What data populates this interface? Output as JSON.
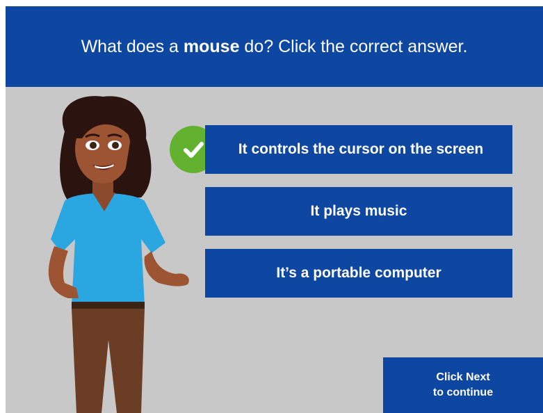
{
  "question": {
    "before": "What does a ",
    "strong": "mouse",
    "after": " do? Click the correct answer."
  },
  "answers": [
    {
      "label": "It controls the cursor on the screen",
      "state": "correct"
    },
    {
      "label": "It plays music",
      "state": "default"
    },
    {
      "label": "It’s a portable computer",
      "state": "default"
    }
  ],
  "icons": {
    "correct": "checkmark-icon"
  },
  "next": {
    "line1": "Click Next",
    "line2": "to continue"
  },
  "colors": {
    "header": "#0d47a1",
    "button": "#0d47a1",
    "background": "#c8c8c8",
    "check": "#62b22f"
  }
}
